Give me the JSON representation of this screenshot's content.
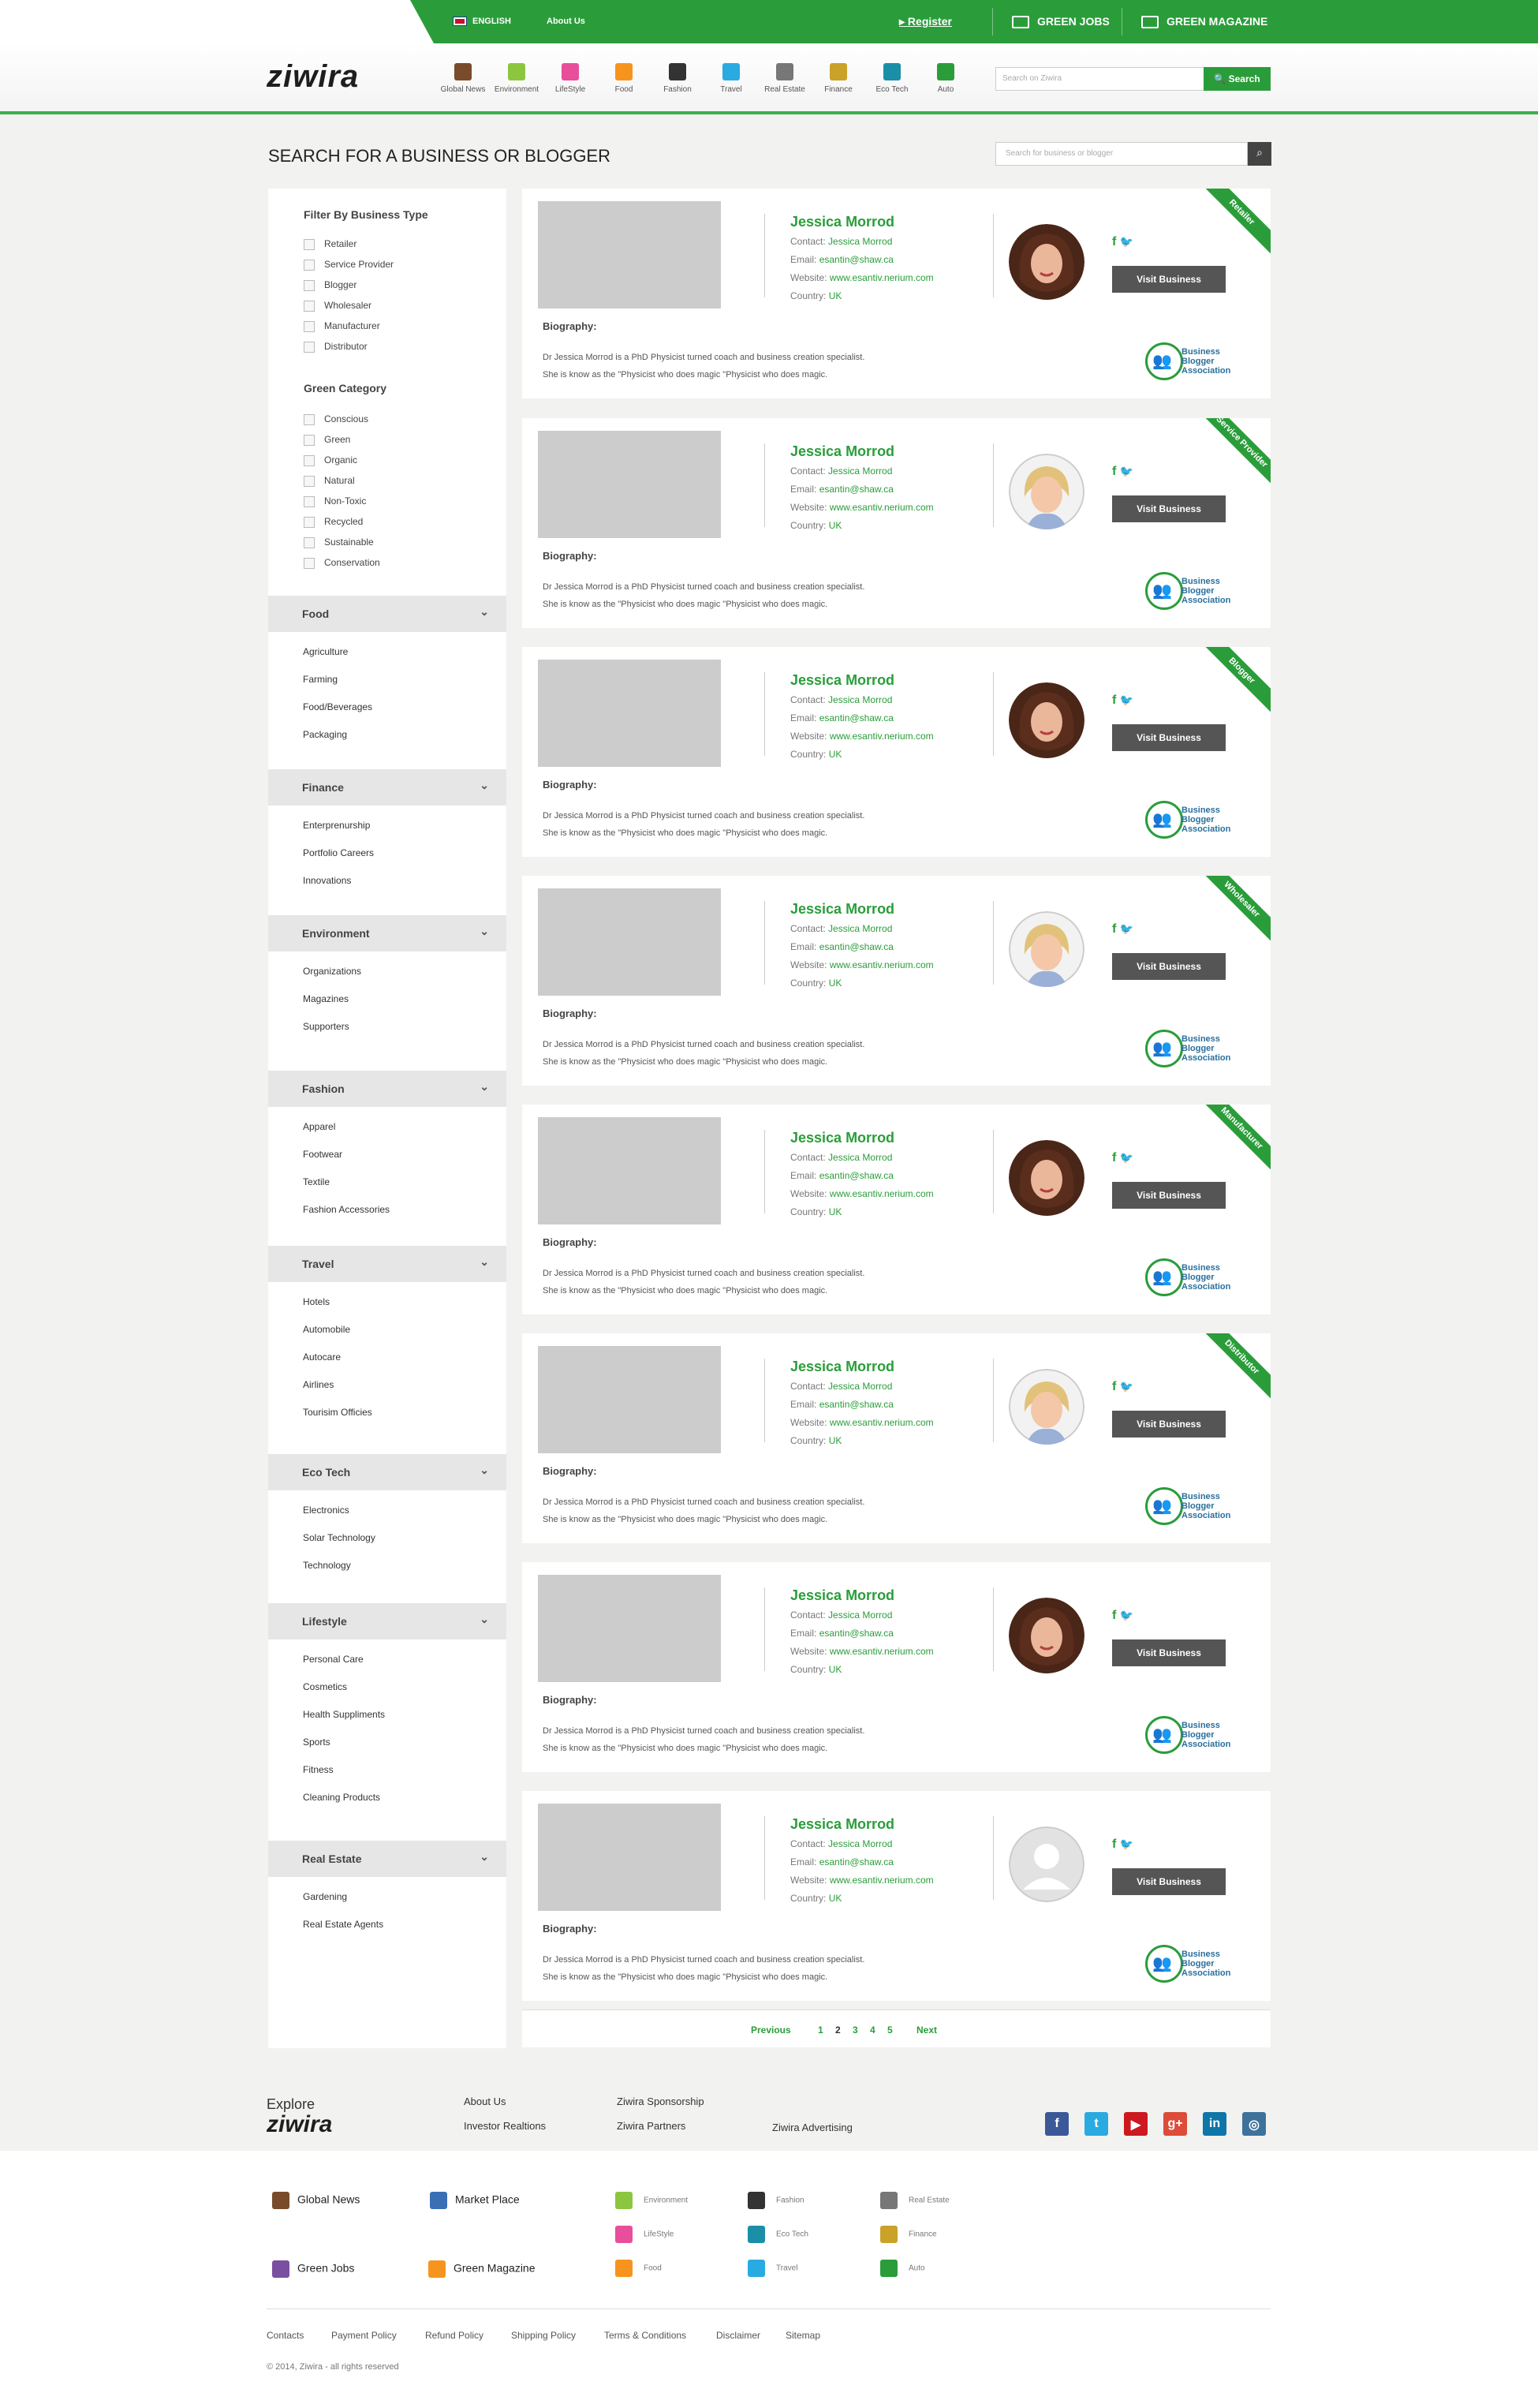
{
  "topbar": {
    "language": "ENGLISH",
    "about": "About Us",
    "register": "Register",
    "green_jobs": "GREEN JOBS",
    "green_magazine": "GREEN MAGAZINE"
  },
  "header": {
    "logo": "ziwira",
    "categories": [
      {
        "label": "Global News",
        "color": "#7a4b2a"
      },
      {
        "label": "Environment",
        "color": "#8cc63f"
      },
      {
        "label": "LifeStyle",
        "color": "#e94e9a"
      },
      {
        "label": "Food",
        "color": "#f7941d"
      },
      {
        "label": "Fashion",
        "color": "#333333"
      },
      {
        "label": "Travel",
        "color": "#29abe2"
      },
      {
        "label": "Real Estate",
        "color": "#777777"
      },
      {
        "label": "Finance",
        "color": "#c9a227"
      },
      {
        "label": "Eco Tech",
        "color": "#1b8fa8"
      },
      {
        "label": "Auto",
        "color": "#2a9d3a"
      }
    ],
    "search_placeholder": "Search on Ziwira",
    "search_button": "Search"
  },
  "page": {
    "title": "SEARCH FOR A BUSINESS OR BLOGGER",
    "search_placeholder": "Search for business or blogger"
  },
  "sidebar": {
    "business_type_title": "Filter By Business Type",
    "business_types": [
      "Retailer",
      "Service Provider",
      "Blogger",
      "Wholesaler",
      "Manufacturer",
      "Distributor"
    ],
    "green_category_title": "Green Category",
    "green_categories": [
      "Conscious",
      "Green",
      "Organic",
      "Natural",
      "Non-Toxic",
      "Recycled",
      "Sustainable",
      "Conservation"
    ],
    "sections": [
      {
        "title": "Food",
        "items": [
          "Agriculture",
          "Farming",
          "Food/Beverages",
          "Packaging"
        ]
      },
      {
        "title": "Finance",
        "items": [
          "Enterprenurship",
          "Portfolio Careers",
          "Innovations"
        ]
      },
      {
        "title": "Environment",
        "items": [
          "Organizations",
          "Magazines",
          "Supporters"
        ]
      },
      {
        "title": "Fashion",
        "items": [
          "Apparel",
          "Footwear",
          "Textile",
          "Fashion Accessories"
        ]
      },
      {
        "title": "Travel",
        "items": [
          "Hotels",
          "Automobile",
          "Autocare",
          "Airlines",
          "Tourisim Officies"
        ]
      },
      {
        "title": "Eco Tech",
        "items": [
          "Electronics",
          "Solar Technology",
          "Technology"
        ]
      },
      {
        "title": "Lifestyle",
        "items": [
          "Personal Care",
          "Cosmetics",
          "Health Suppliments",
          "Sports",
          "Fitness",
          "Cleaning Products"
        ]
      },
      {
        "title": "Real Estate",
        "items": [
          "Gardening",
          "Real Estate Agents"
        ]
      }
    ]
  },
  "card_labels": {
    "contact": "Contact:",
    "email": "Email:",
    "website": "Website:",
    "country": "Country:",
    "biography": "Biography:",
    "visit": "Visit Business",
    "bba_line1": "Business",
    "bba_line2": "Blogger",
    "bba_line3": "Association"
  },
  "cards": [
    {
      "name": "Jessica Morrod",
      "contact": "Jessica Morrod",
      "email": "esantin@shaw.ca",
      "website": "www.esantiv.nerium.com",
      "country": "UK",
      "ribbon": "Retailer",
      "avatar": "brunette",
      "bio1": "Dr Jessica Morrod is a PhD Physicist turned coach and business creation specialist.",
      "bio2": "She is know as the \"Physicist who does magic \"Physicist who does magic."
    },
    {
      "name": "Jessica Morrod",
      "contact": "Jessica Morrod",
      "email": "esantin@shaw.ca",
      "website": "www.esantiv.nerium.com",
      "country": "UK",
      "ribbon": "Service Provider",
      "avatar": "blonde",
      "bio1": "Dr Jessica Morrod is a PhD Physicist turned coach and business creation specialist.",
      "bio2": "She is know as the \"Physicist who does magic \"Physicist who does magic."
    },
    {
      "name": "Jessica Morrod",
      "contact": "Jessica Morrod",
      "email": "esantin@shaw.ca",
      "website": "www.esantiv.nerium.com",
      "country": "UK",
      "ribbon": "Blogger",
      "avatar": "brunette",
      "bio1": "Dr Jessica Morrod is a PhD Physicist turned coach and business creation specialist.",
      "bio2": "She is know as the \"Physicist who does magic \"Physicist who does magic."
    },
    {
      "name": "Jessica Morrod",
      "contact": "Jessica Morrod",
      "email": "esantin@shaw.ca",
      "website": "www.esantiv.nerium.com",
      "country": "UK",
      "ribbon": "Wholesaler",
      "avatar": "blonde",
      "bio1": "Dr Jessica Morrod is a PhD Physicist turned coach and business creation specialist.",
      "bio2": "She is know as the \"Physicist who does magic \"Physicist who does magic."
    },
    {
      "name": "Jessica Morrod",
      "contact": "Jessica Morrod",
      "email": "esantin@shaw.ca",
      "website": "www.esantiv.nerium.com",
      "country": "UK",
      "ribbon": "Manufacturer",
      "avatar": "brunette",
      "bio1": "Dr Jessica Morrod is a PhD Physicist turned coach and business creation specialist.",
      "bio2": "She is know as the \"Physicist who does magic \"Physicist who does magic."
    },
    {
      "name": "Jessica Morrod",
      "contact": "Jessica Morrod",
      "email": "esantin@shaw.ca",
      "website": "www.esantiv.nerium.com",
      "country": "UK",
      "ribbon": "Distributor",
      "avatar": "blonde",
      "bio1": "Dr Jessica Morrod is a PhD Physicist turned coach and business creation specialist.",
      "bio2": "She is know as the \"Physicist who does magic \"Physicist who does magic."
    },
    {
      "name": "Jessica Morrod",
      "contact": "Jessica Morrod",
      "email": "esantin@shaw.ca",
      "website": "www.esantiv.nerium.com",
      "country": "UK",
      "ribbon": "",
      "avatar": "brunette",
      "bio1": "Dr Jessica Morrod is a PhD Physicist turned coach and business creation specialist.",
      "bio2": "She is know as the \"Physicist who does magic \"Physicist who does magic."
    },
    {
      "name": "Jessica Morrod",
      "contact": "Jessica Morrod",
      "email": "esantin@shaw.ca",
      "website": "www.esantiv.nerium.com",
      "country": "UK",
      "ribbon": "",
      "avatar": "placeholder",
      "bio1": "Dr Jessica Morrod is a PhD Physicist turned coach and business creation specialist.",
      "bio2": "She is know as the \"Physicist who does magic \"Physicist who does magic."
    }
  ],
  "pagination": {
    "previous": "Previous",
    "pages": [
      "1",
      "2",
      "3",
      "4",
      "5"
    ],
    "current": "2",
    "next": "Next"
  },
  "footer": {
    "explore": "Explore",
    "logo": "ziwira",
    "links": [
      "About Us",
      "Investor Realtions",
      "Ziwira Sponsorship",
      "Ziwira Partners",
      "Ziwira Advertising"
    ],
    "social": [
      {
        "name": "facebook-icon",
        "glyph": "f",
        "color": "#3b5998"
      },
      {
        "name": "twitter-icon",
        "glyph": "t",
        "color": "#29abe2"
      },
      {
        "name": "youtube-icon",
        "glyph": "▶",
        "color": "#cc181e"
      },
      {
        "name": "googleplus-icon",
        "glyph": "g+",
        "color": "#dd4b39"
      },
      {
        "name": "linkedin-icon",
        "glyph": "in",
        "color": "#0e76a8"
      },
      {
        "name": "instagram-icon",
        "glyph": "◎",
        "color": "#3f729b"
      }
    ],
    "main_cats": [
      {
        "label": "Global News",
        "color": "#7a4b2a"
      },
      {
        "label": "Market Place",
        "color": "#3a6fb5"
      },
      {
        "label": "Green Jobs",
        "color": "#7b4fa0"
      },
      {
        "label": "Green Magazine",
        "color": "#f7941d"
      }
    ],
    "small_cats": [
      {
        "label": "Environment",
        "color": "#8cc63f"
      },
      {
        "label": "LifeStyle",
        "color": "#e94e9a"
      },
      {
        "label": "Food",
        "color": "#f7941d"
      },
      {
        "label": "Fashion",
        "color": "#333333"
      },
      {
        "label": "Eco Tech",
        "color": "#1b8fa8"
      },
      {
        "label": "Travel",
        "color": "#29abe2"
      },
      {
        "label": "Real Estate",
        "color": "#777777"
      },
      {
        "label": "Finance",
        "color": "#c9a227"
      },
      {
        "label": "Auto",
        "color": "#2a9d3a"
      }
    ],
    "nav": [
      "Contacts",
      "Payment Policy",
      "Refund Policy",
      "Shipping Policy",
      "Terms & Conditions",
      "Disclaimer",
      "Sitemap"
    ],
    "copyright": "© 2014, Ziwira - all rights reserved"
  }
}
